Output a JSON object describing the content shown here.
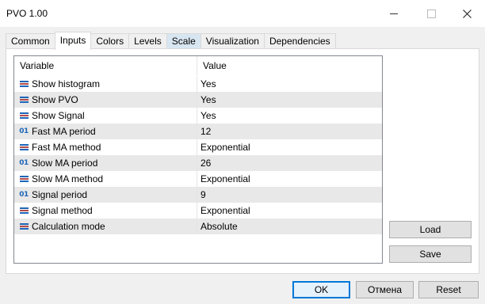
{
  "window": {
    "title": "PVO 1.00"
  },
  "tabs": [
    {
      "label": "Common"
    },
    {
      "label": "Inputs"
    },
    {
      "label": "Colors"
    },
    {
      "label": "Levels"
    },
    {
      "label": "Scale"
    },
    {
      "label": "Visualization"
    },
    {
      "label": "Dependencies"
    }
  ],
  "grid": {
    "columns": {
      "variable": "Variable",
      "value": "Value"
    },
    "rows": [
      {
        "icon": "enum-icon",
        "variable": "Show histogram",
        "value": "Yes"
      },
      {
        "icon": "enum-icon",
        "variable": "Show PVO",
        "value": "Yes"
      },
      {
        "icon": "enum-icon",
        "variable": "Show Signal",
        "value": "Yes"
      },
      {
        "icon": "integer-icon",
        "icon_text": "01",
        "variable": "Fast MA period",
        "value": "12"
      },
      {
        "icon": "enum-icon",
        "variable": "Fast MA method",
        "value": "Exponential"
      },
      {
        "icon": "integer-icon",
        "icon_text": "01",
        "variable": "Slow MA period",
        "value": "26"
      },
      {
        "icon": "enum-icon",
        "variable": "Slow MA method",
        "value": "Exponential"
      },
      {
        "icon": "integer-icon",
        "icon_text": "01",
        "variable": "Signal period",
        "value": "9"
      },
      {
        "icon": "enum-icon",
        "variable": "Signal method",
        "value": "Exponential"
      },
      {
        "icon": "enum-icon",
        "variable": "Calculation mode",
        "value": "Absolute"
      }
    ]
  },
  "buttons": {
    "load": "Load",
    "save": "Save",
    "ok": "OK",
    "cancel": "Отмена",
    "reset": "Reset"
  },
  "colors": {
    "accent": "#0078d7",
    "icon_blue": "#1e66b8",
    "row_alt": "#e8e8e8"
  }
}
